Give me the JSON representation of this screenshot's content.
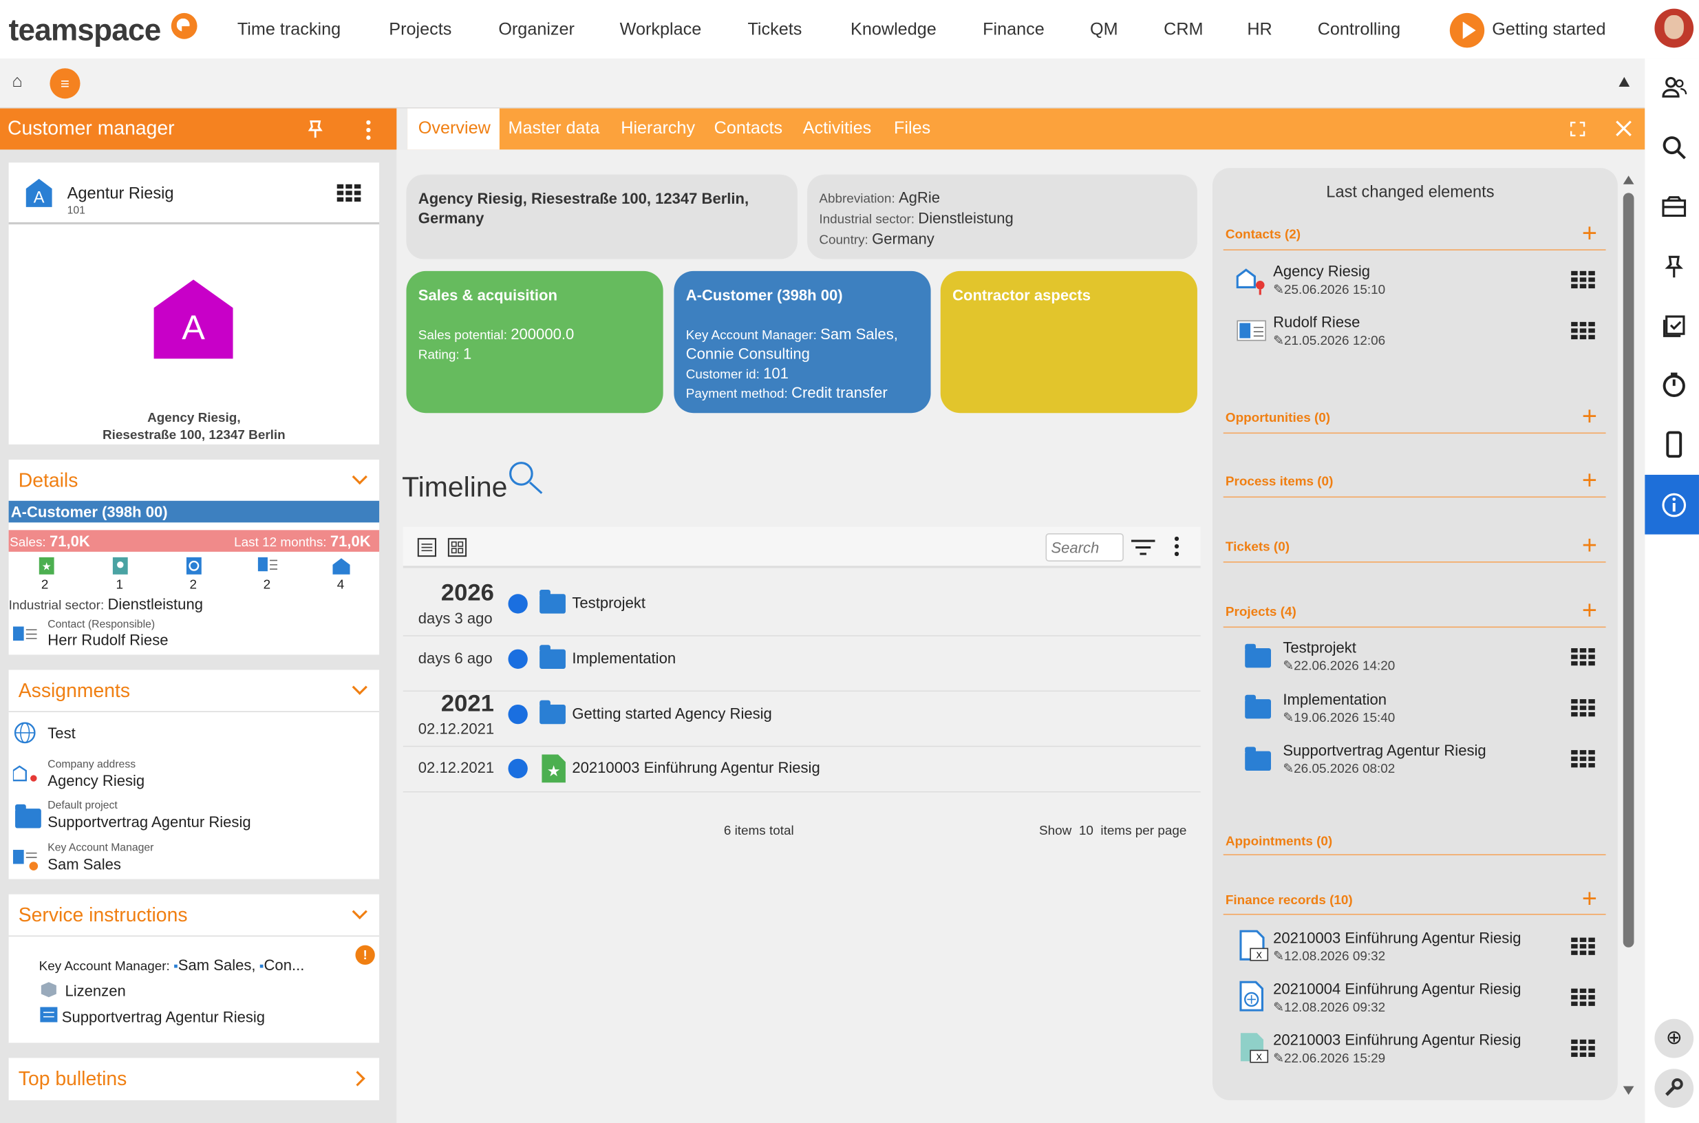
{
  "app": {
    "logo": "teamspace"
  },
  "topnav": {
    "items": [
      "Time tracking",
      "Projects",
      "Organizer",
      "Workplace",
      "Tickets",
      "Knowledge",
      "Finance",
      "QM",
      "CRM",
      "HR",
      "Controlling"
    ],
    "getting_started": "Getting started"
  },
  "left": {
    "title": "Customer manager",
    "company": {
      "name": "Agentur Riesig",
      "number": "101",
      "avatar_letter": "A",
      "avatar_color": "#c800c8",
      "address_line1": "Agency Riesig,",
      "address_line2": "Riesestraße 100, 12347 Berlin"
    },
    "details": {
      "title": "Details",
      "class_bar": "A-Customer (398h 00)",
      "sales_label": "Sales:",
      "sales_value": "71,0K",
      "last12_label": "Last 12 months:",
      "last12_value": "71,0K",
      "counts": [
        "2",
        "1",
        "2",
        "2",
        "4"
      ],
      "industrial_label": "Industrial sector:",
      "industrial_value": "Dienstleistung",
      "contact_label": "Contact (Responsible)",
      "contact_value": "Herr Rudolf Riese"
    },
    "assignments": {
      "title": "Assignments",
      "globe_item": "Test",
      "company_address_label": "Company address",
      "company_address_value": "Agency Riesig",
      "default_project_label": "Default project",
      "default_project_value": "Supportvertrag Agentur Riesig",
      "kam_label": "Key Account Manager",
      "kam_value": "Sam Sales"
    },
    "service": {
      "title": "Service instructions",
      "kam_label": "Key Account Manager:",
      "kam_v1": "Sam Sales,",
      "kam_v2": "Con...",
      "item2": "Lizenzen",
      "item3": "Supportvertrag Agentur Riesig"
    },
    "bulletins": {
      "title": "Top bulletins"
    }
  },
  "tabs": [
    "Overview",
    "Master data",
    "Hierarchy",
    "Contacts",
    "Activities",
    "Files"
  ],
  "overview": {
    "address": "Agency Riesig, Riesestraße 100, 12347 Berlin, Germany",
    "abbr_label": "Abbreviation:",
    "abbr_value": "AgRie",
    "sector_label": "Industrial sector:",
    "sector_value": "Dienstleistung",
    "country_label": "Country:",
    "country_value": "Germany",
    "tile_sales": {
      "title": "Sales & acquisition",
      "potential_label": "Sales potential:",
      "potential_value": "200000.0",
      "rating_label": "Rating:",
      "rating_value": "1",
      "color": "#66bb5e"
    },
    "tile_customer": {
      "title": "A-Customer (398h 00)",
      "kam_label": "Key Account Manager:",
      "kam_value": "Sam Sales,",
      "kam_value2": "Connie Consulting",
      "cid_label": "Customer id:",
      "cid_value": "101",
      "pay_label": "Payment method:",
      "pay_value": "Credit transfer",
      "color": "#3d80c0"
    },
    "tile_contractor": {
      "title": "Contractor aspects",
      "color": "#e2c52c"
    }
  },
  "timeline": {
    "title": "Timeline",
    "search_placeholder": "Search",
    "rows": [
      {
        "year": "2026",
        "date": "days 3 ago",
        "label": "Testprojekt"
      },
      {
        "year": "",
        "date": "days 6 ago",
        "label": "Implementation"
      },
      {
        "year": "2021",
        "date": "02.12.2021",
        "label": "Getting started Agency Riesig"
      },
      {
        "year": "",
        "date": "02.12.2021",
        "label": "20210003 Einführung Agentur Riesig"
      }
    ],
    "total": "6 items total",
    "show": "Show",
    "per_page_value": "10",
    "per_page_suffix": "items per page"
  },
  "right": {
    "title": "Last changed elements",
    "contacts": {
      "label": "Contacts (2)",
      "items": [
        {
          "name": "Agency Riesig",
          "date": "25.06.2026 15:10"
        },
        {
          "name": "Rudolf Riese",
          "date": "21.05.2026 12:06"
        }
      ]
    },
    "opportunities": "Opportunities (0)",
    "process": "Process items (0)",
    "tickets": "Tickets (0)",
    "projects": {
      "label": "Projects (4)",
      "items": [
        {
          "name": "Testprojekt",
          "date": "22.06.2026 14:20"
        },
        {
          "name": "Implementation",
          "date": "19.06.2026 15:40"
        },
        {
          "name": "Supportvertrag Agentur Riesig",
          "date": "26.05.2026 08:02"
        }
      ]
    },
    "appointments": "Appointments (0)",
    "finance": {
      "label": "Finance records (10)",
      "items": [
        {
          "name": "20210003 Einführung Agentur Riesig",
          "date": "12.08.2026 09:32"
        },
        {
          "name": "20210004 Einführung Agentur Riesig",
          "date": "12.08.2026 09:32"
        },
        {
          "name": "20210003 Einführung Agentur Riesig",
          "date": "22.06.2026 15:29"
        }
      ]
    }
  },
  "colors": {
    "accent": "#f58220",
    "tabbar": "#fca23c",
    "active_blue": "#1e6fd9"
  }
}
